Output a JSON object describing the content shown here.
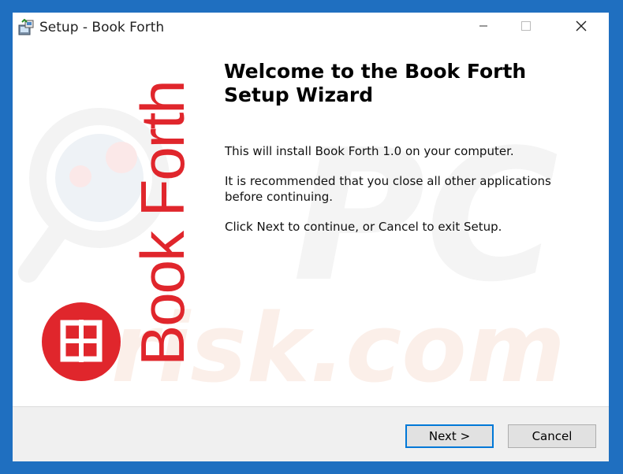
{
  "window": {
    "title": "Setup - Book Forth",
    "icons": {
      "app": "installer-icon",
      "minimize": "minimize-icon",
      "maximize": "maximize-icon",
      "close": "close-icon"
    }
  },
  "sidebar": {
    "brand_logo": "book-forth-logo",
    "brand_text": "Book Forth",
    "brand_color": "#e0262c",
    "watermark": "pcrisk.com"
  },
  "main": {
    "heading": "Welcome to the Book Forth Setup Wizard",
    "paragraphs": [
      "This will install Book Forth 1.0 on your computer.",
      "It is recommended that you close all other applications before continuing.",
      "Click Next to continue, or Cancel to exit Setup."
    ]
  },
  "footer": {
    "next_label": "Next >",
    "cancel_label": "Cancel"
  },
  "colors": {
    "window_border": "#1f6fc0",
    "focus_border": "#0078d7",
    "footer_bg": "#f0f0f0"
  }
}
